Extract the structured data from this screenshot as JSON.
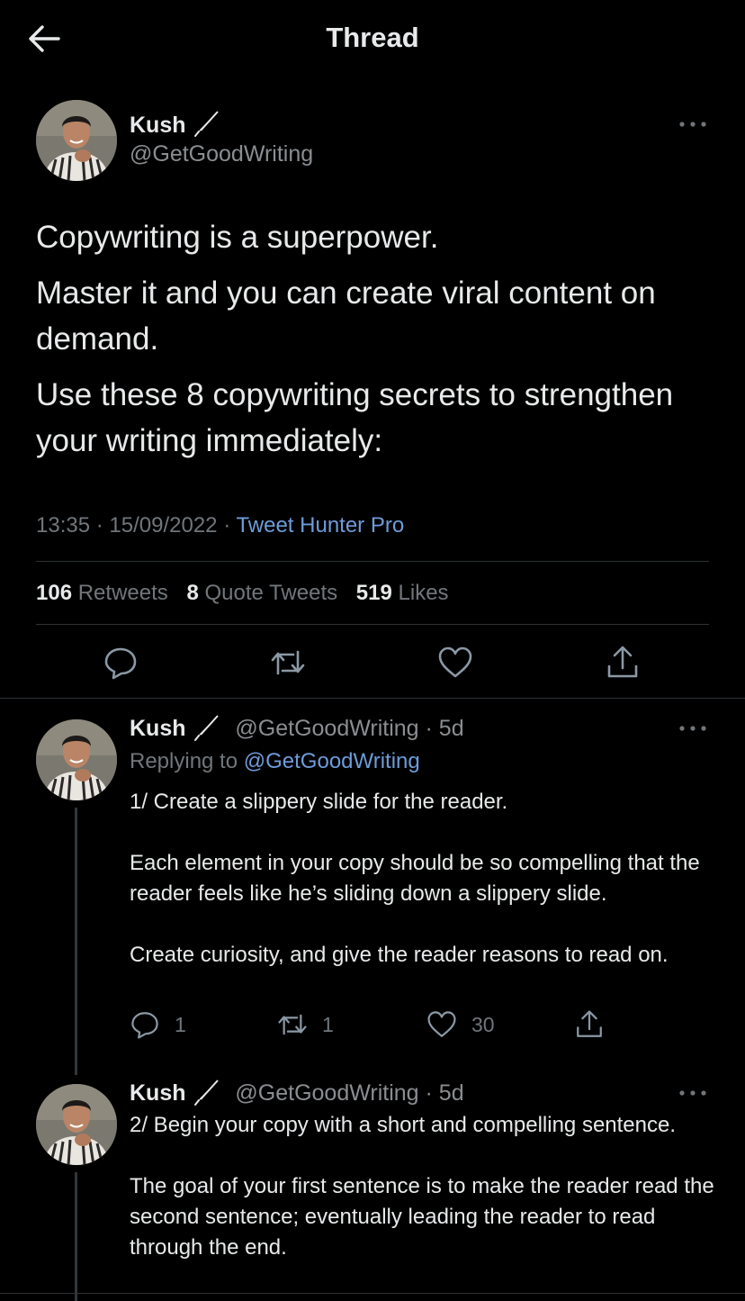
{
  "header": {
    "title": "Thread"
  },
  "main_tweet": {
    "author_name": "Kush",
    "handle": "@GetGoodWriting",
    "paragraphs": [
      "Copywriting is a superpower.",
      "Master it and you can create viral content on demand.",
      "Use these 8 copywriting secrets to strengthen your writing immediately:"
    ],
    "time": "13:35",
    "date": "15/09/2022",
    "source": "Tweet Hunter Pro",
    "retweets_count": "106",
    "retweets_label": "Retweets",
    "quotes_count": "8",
    "quotes_label": "Quote Tweets",
    "likes_count": "519",
    "likes_label": "Likes"
  },
  "replies": [
    {
      "author_name": "Kush",
      "handle": "@GetGoodWriting",
      "age": "5d",
      "replying_prefix": "Replying to",
      "replying_to": "@GetGoodWriting",
      "text": "1/ Create a slippery slide for the reader.\n\nEach element in your copy should be so compelling that the reader feels like he’s sliding down a slippery slide.\n\nCreate curiosity, and give the reader reasons to read on.",
      "reply_count": "1",
      "retweet_count": "1",
      "like_count": "30"
    },
    {
      "author_name": "Kush",
      "handle": "@GetGoodWriting",
      "age": "5d",
      "text": "2/ Begin your copy with a short and compelling sentence.\n\nThe goal of your first sentence is to make the reader read the second sentence; eventually leading the reader to read through the end."
    }
  ],
  "colors": {
    "background": "#000000",
    "text": "#e7e9ea",
    "muted": "#71767b",
    "link": "#6e9bd9",
    "divider": "#2f3336"
  },
  "icons": [
    "back-arrow-icon",
    "more-icon",
    "pen-icon",
    "reply-icon",
    "retweet-icon",
    "like-icon",
    "share-icon"
  ]
}
